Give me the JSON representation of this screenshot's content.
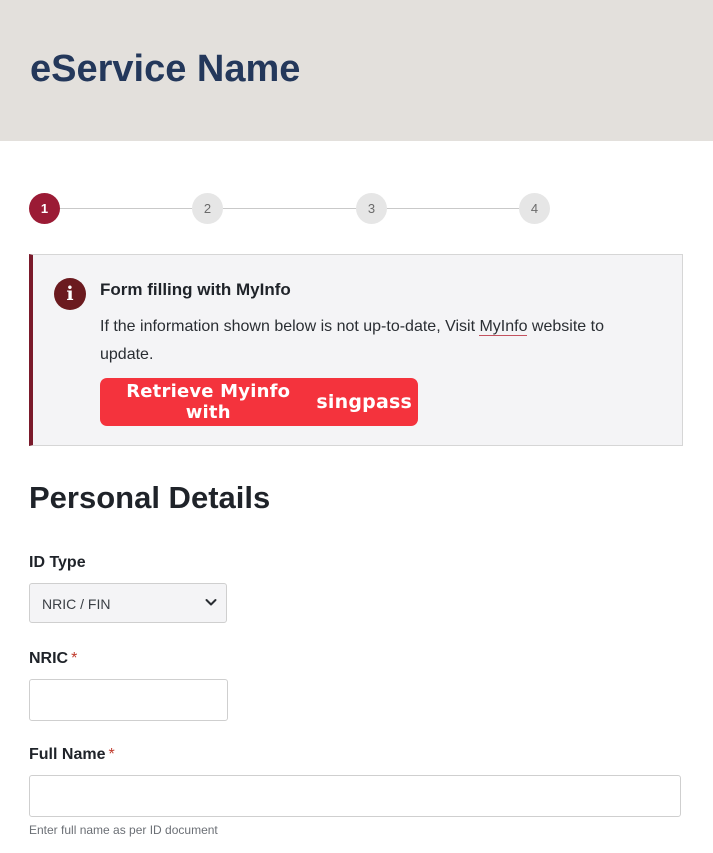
{
  "header": {
    "title": "eService Name"
  },
  "stepper": {
    "steps": [
      "1",
      "2",
      "3",
      "4"
    ],
    "active": 1
  },
  "myinfo": {
    "title": "Form filling with MyInfo",
    "text_before": "If the information shown below is not up-to-date, Visit ",
    "link": "MyInfo",
    "text_after": " website to update.",
    "button_text": "Retrieve Myinfo with",
    "button_brand": "singpass",
    "icon": "info-icon",
    "accent": "#f4333d"
  },
  "form": {
    "section_title": "Personal Details",
    "id_type": {
      "label": "ID Type",
      "value": "NRIC / FIN"
    },
    "nric": {
      "label": "NRIC",
      "required": "*",
      "value": ""
    },
    "full_name": {
      "label": "Full Name",
      "required": "*",
      "value": "",
      "hint": "Enter full name as per ID document"
    }
  }
}
